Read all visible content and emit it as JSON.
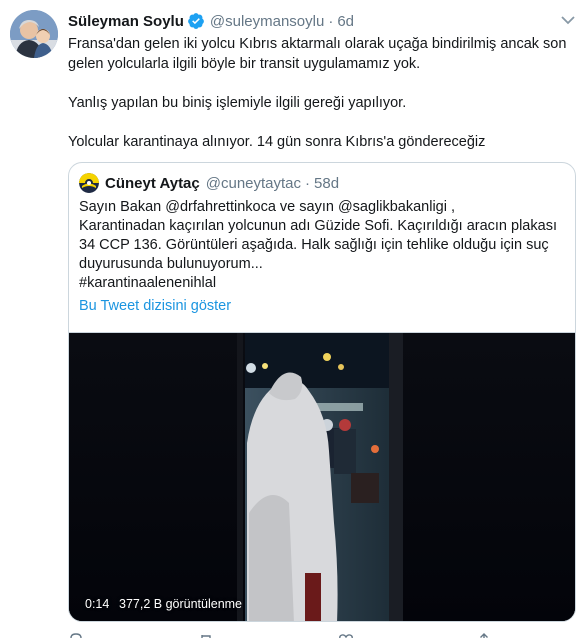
{
  "tweet": {
    "author_name": "Süleyman Soylu",
    "author_handle": "@suleymansoylu",
    "separator": "·",
    "timestamp": "6d",
    "paragraphs": [
      "Fransa'dan gelen iki yolcu Kıbrıs aktarmalı olarak uçağa bindirilmiş ancak son gelen yolcularla ilgili böyle bir transit uygulamamız yok.",
      "Yanlış yapılan bu biniş işlemiyle ilgili gereği yapılıyor.",
      "Yolcular karantinaya alınıyor. 14 gün sonra Kıbrıs'a göndereceğiz"
    ],
    "icons": [
      "avatar",
      "verified-badge-icon",
      "chevron-down-icon"
    ]
  },
  "quoted": {
    "author_name": "Cüneyt Aytaç",
    "author_handle": "@cuneytaytac",
    "separator": "·",
    "timestamp": "58d",
    "lines": [
      "Sayın Bakan @drfahrettinkoca ve sayın @saglikbakanligi ,",
      "Karantinadan kaçırılan yolcunun adı Güzide Sofi. Kaçırıldığı aracın plakası",
      "34 CCP 136. Görüntüleri aşağıda. Halk sağlığı için tehlike olduğu için suç",
      "duyurusunda bulunuyorum...",
      "#karantinaalenenihlal"
    ],
    "thread_link": "Bu Tweet dizisini göster",
    "video": {
      "duration": "0:14",
      "views": "377,2 B görüntülenme"
    }
  },
  "colors": {
    "link": "#1b95e0",
    "secondary_text": "#657786",
    "border": "#ccd6dd",
    "verified": "#1da1f2"
  }
}
